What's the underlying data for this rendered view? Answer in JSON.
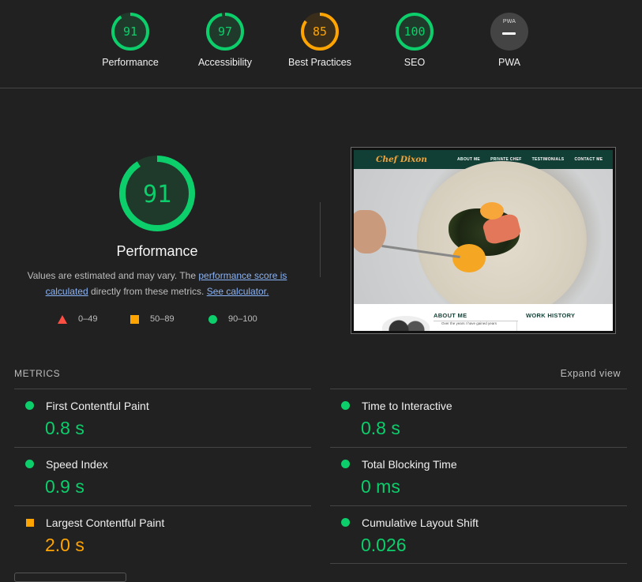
{
  "summary": [
    {
      "label": "Performance",
      "score": "91",
      "value": 0.91,
      "color": "#0cce6b"
    },
    {
      "label": "Accessibility",
      "score": "97",
      "value": 0.97,
      "color": "#0cce6b"
    },
    {
      "label": "Best Practices",
      "score": "85",
      "value": 0.85,
      "color": "#ffa400"
    },
    {
      "label": "SEO",
      "score": "100",
      "value": 1.0,
      "color": "#0cce6b"
    },
    {
      "label": "PWA",
      "badge": "PWA",
      "icon": "pwa-icon"
    }
  ],
  "performance": {
    "score": "91",
    "value": 0.91,
    "title": "Performance",
    "desc_prefix": "Values are estimated and may vary. The ",
    "link_score": "performance score is calculated",
    "desc_middle": " directly from these metrics. ",
    "link_calc": "See calculator.",
    "legend": [
      {
        "range": "0–49",
        "icon": "triangle-fail-icon",
        "color": "#ff4e42"
      },
      {
        "range": "50–89",
        "icon": "square-average-icon",
        "color": "#ffa400"
      },
      {
        "range": "90–100",
        "icon": "circle-pass-icon",
        "color": "#0cce6b"
      }
    ]
  },
  "preview": {
    "logo": "Chef Dixon",
    "nav": [
      "ABOUT ME",
      "PRIVATE CHEF",
      "TESTIMONIALS",
      "CONTACT ME"
    ],
    "about_heading": "ABOUT ME",
    "work_heading": "WORK HISTORY",
    "about_text": "Over the years I have gained years"
  },
  "metrics": {
    "header": "METRICS",
    "expand": "Expand view",
    "items": [
      {
        "name": "First Contentful Paint",
        "value": "0.8 s",
        "status": "pass"
      },
      {
        "name": "Time to Interactive",
        "value": "0.8 s",
        "status": "pass"
      },
      {
        "name": "Speed Index",
        "value": "0.9 s",
        "status": "pass"
      },
      {
        "name": "Total Blocking Time",
        "value": "0 ms",
        "status": "pass"
      },
      {
        "name": "Largest Contentful Paint",
        "value": "2.0 s",
        "status": "average"
      },
      {
        "name": "Cumulative Layout Shift",
        "value": "0.026",
        "status": "pass"
      }
    ]
  },
  "colors": {
    "pass": "#0cce6b",
    "average": "#ffa400",
    "fail": "#ff4e42",
    "background": "#212121"
  }
}
